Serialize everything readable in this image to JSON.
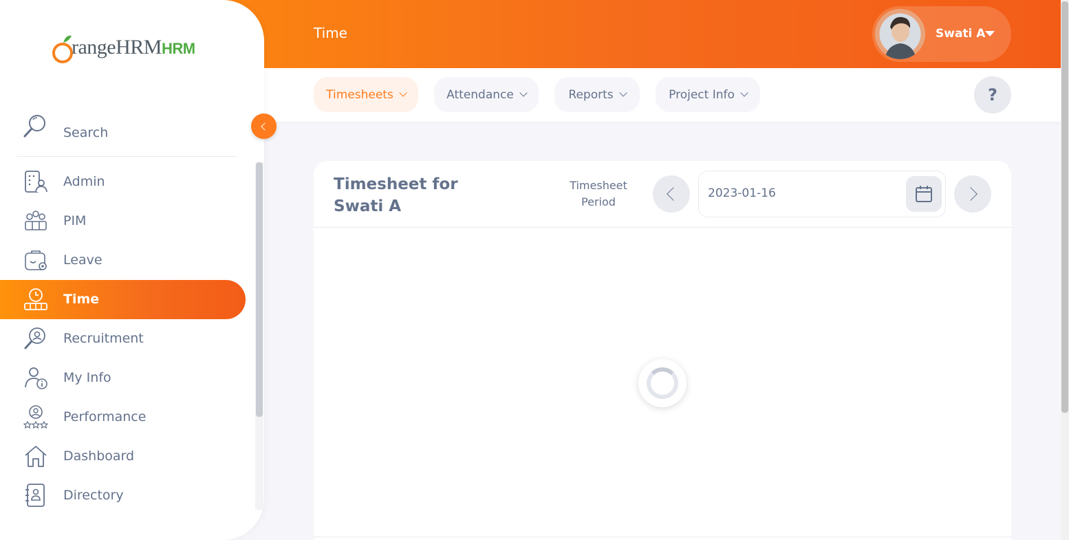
{
  "brand": {
    "logo_main": "rangeHRM",
    "logo_o": "O",
    "logo_hrm": "HRM",
    "accent": "#ff7b1d",
    "gradient_start": "#ff920b",
    "gradient_end": "#f35c17"
  },
  "header": {
    "title": "Time",
    "user_name": "Swati A"
  },
  "subnav": {
    "tabs": [
      {
        "label": "Timesheets",
        "active": true
      },
      {
        "label": "Attendance",
        "active": false
      },
      {
        "label": "Reports",
        "active": false
      },
      {
        "label": "Project Info",
        "active": false
      }
    ],
    "help_label": "?"
  },
  "sidebar": {
    "search_label": "Search",
    "items": [
      {
        "label": "Admin",
        "icon": "admin-icon"
      },
      {
        "label": "PIM",
        "icon": "pim-icon"
      },
      {
        "label": "Leave",
        "icon": "leave-icon"
      },
      {
        "label": "Time",
        "icon": "time-icon",
        "active": true
      },
      {
        "label": "Recruitment",
        "icon": "recruitment-icon"
      },
      {
        "label": "My Info",
        "icon": "my-info-icon"
      },
      {
        "label": "Performance",
        "icon": "performance-icon"
      },
      {
        "label": "Dashboard",
        "icon": "dashboard-icon"
      },
      {
        "label": "Directory",
        "icon": "directory-icon"
      }
    ]
  },
  "timesheet": {
    "title": "Timesheet for Swati A",
    "period_label": "Timesheet Period",
    "date_value": "2023-01-16",
    "loading": true
  }
}
